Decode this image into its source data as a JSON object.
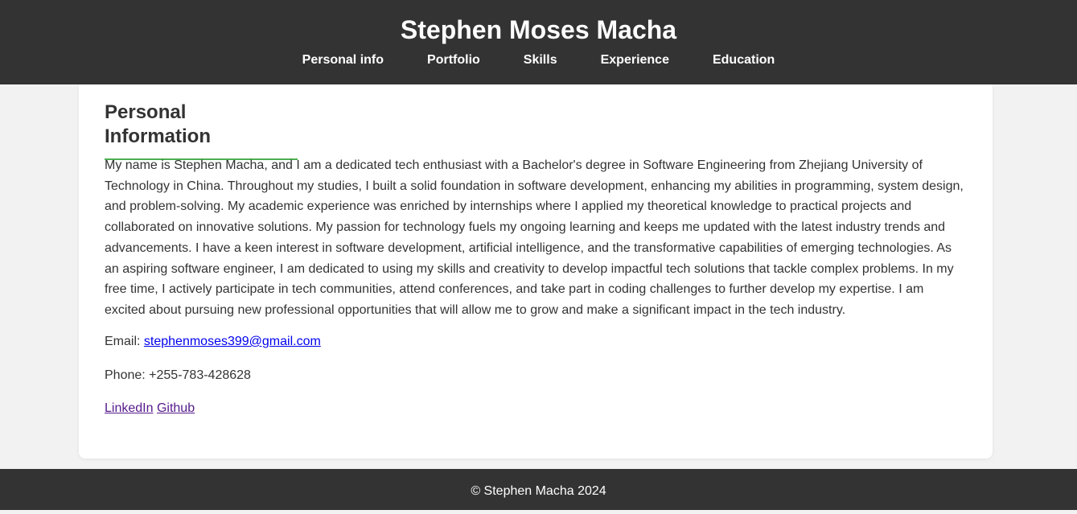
{
  "header": {
    "title": "Stephen Moses Macha",
    "nav": [
      {
        "label": "Personal info"
      },
      {
        "label": "Portfolio"
      },
      {
        "label": "Skills"
      },
      {
        "label": "Experience"
      },
      {
        "label": "Education"
      }
    ]
  },
  "personal": {
    "heading": "Personal Information",
    "bio": "My name is Stephen Macha, and I am a dedicated tech enthusiast with a Bachelor's degree in Software Engineering from Zhejiang University of Technology in China. Throughout my studies, I built a solid foundation in software development, enhancing my abilities in programming, system design, and problem-solving. My academic experience was enriched by internships where I applied my theoretical knowledge to practical projects and collaborated on innovative solutions. My passion for technology fuels my ongoing learning and keeps me updated with the latest industry trends and advancements. I have a keen interest in software development, artificial intelligence, and the transformative capabilities of emerging technologies. As an aspiring software engineer, I am dedicated to using my skills and creativity to develop impactful tech solutions that tackle complex problems. In my free time, I actively participate in tech communities, attend conferences, and take part in coding challenges to further develop my expertise. I am excited about pursuing new professional opportunities that will allow me to grow and make a significant impact in the tech industry.",
    "email_label": "Email: ",
    "email": "stephenmoses399@gmail.com",
    "phone_label": "Phone: ",
    "phone": "+255-783-428628",
    "links": [
      {
        "label": "LinkedIn"
      },
      {
        "label": "Github"
      }
    ]
  },
  "footer": {
    "text": "© Stephen Macha 2024"
  },
  "colors": {
    "header_bg": "#333333",
    "accent": "#4caf50",
    "page_bg": "#f2f2f2",
    "link": "#0000ee",
    "visited_link": "#551a8b"
  }
}
